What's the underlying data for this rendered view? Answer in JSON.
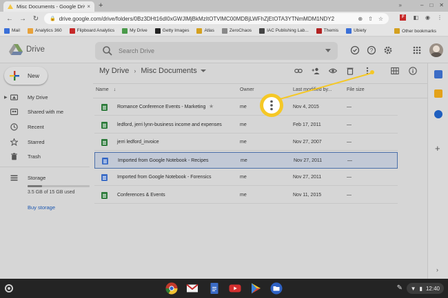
{
  "browser": {
    "tab_title": "Misc Documents - Google Drive",
    "tab_close": "×",
    "new_tab": "+",
    "url": "drive.google.com/drive/folders/0Bz3DHt16dI0xGWJlMjBkMzItOTVlMC00MDBjLWFhZjEtOTA3YTNmMDM1NDY2",
    "window_buttons": [
      "–",
      "□",
      "✕"
    ]
  },
  "bookmarks": [
    {
      "label": "Mail",
      "color": "#3a6fd8"
    },
    {
      "label": "Analytics 360",
      "color": "#e8a23b"
    },
    {
      "label": "Flipboard Analytics",
      "color": "#c62828"
    },
    {
      "label": "My Drive",
      "color": "#4a9a4a"
    },
    {
      "label": "Getty Images",
      "color": "#222222"
    },
    {
      "label": "Atlas",
      "color": "#d4a01f"
    },
    {
      "label": "ZeroChaos",
      "color": "#888888"
    },
    {
      "label": "IAC Publishing Lab...",
      "color": "#444444"
    },
    {
      "label": "Themis",
      "color": "#b22222"
    },
    {
      "label": "Ubiety",
      "color": "#3a6fd8"
    }
  ],
  "bookmarks_more": "»",
  "other_bookmarks": "Other bookmarks",
  "drive": {
    "app_name": "Drive",
    "search_placeholder": "Search Drive",
    "new_label": "New"
  },
  "sidebar": {
    "items": [
      {
        "label": "My Drive",
        "icon": "my-drive-icon"
      },
      {
        "label": "Shared with me",
        "icon": "shared-icon"
      },
      {
        "label": "Recent",
        "icon": "clock-icon"
      },
      {
        "label": "Starred",
        "icon": "star-icon"
      },
      {
        "label": "Trash",
        "icon": "trash-icon"
      }
    ],
    "storage_label": "Storage",
    "storage_text": "3.5 GB of 15 GB used",
    "storage_used_fraction": 0.23,
    "buy_storage": "Buy storage"
  },
  "breadcrumb": {
    "root": "My Drive",
    "separator": "›",
    "current": "Misc Documents"
  },
  "columns": {
    "name": "Name",
    "sort_arrow": "↓",
    "owner": "Owner",
    "modified": "Last modified by...",
    "size": "File size"
  },
  "files": [
    {
      "name": "Romance Conference Events - Marketing",
      "type": "sheet",
      "owner": "me",
      "modified": "Nov 4, 2015",
      "size": "—",
      "starred": true
    },
    {
      "name": "ledford, jerri lynn-business income and expenses",
      "type": "sheet",
      "owner": "me",
      "modified": "Feb 17, 2011",
      "size": "—"
    },
    {
      "name": "jerri ledford_invoice",
      "type": "sheet",
      "owner": "me",
      "modified": "Nov 27, 2007",
      "size": "—"
    },
    {
      "name": "Imported from Google Notebook - Recipes",
      "type": "doc",
      "owner": "me",
      "modified": "Nov 27, 2011",
      "size": "—"
    },
    {
      "name": "Imported from Google Notebook - Forensics",
      "type": "doc",
      "owner": "me",
      "modified": "Nov 27, 2011",
      "size": "—"
    },
    {
      "name": "Conferences & Events",
      "type": "sheet",
      "owner": "me",
      "modified": "Nov 11, 2015",
      "size": "—"
    }
  ],
  "star_glyph": "★",
  "side_panel_add": "+",
  "side_panel_arrow": "›",
  "shelf": {
    "time": "12:40",
    "pen": "✎"
  },
  "colors": {
    "accent_yellow": "#f5c826",
    "drive_blue": "#1a56b0",
    "selection_border": "#4b6fa9"
  }
}
